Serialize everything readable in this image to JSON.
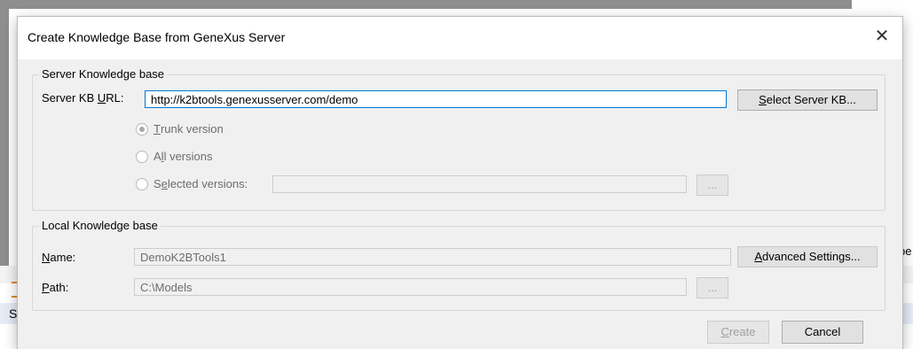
{
  "background": {
    "left_letter": "S",
    "right_text": "pe"
  },
  "dialog": {
    "title": "Create Knowledge Base from GeneXus Server",
    "close_glyph": "✕",
    "server_group": {
      "legend": "Server Knowledge base",
      "kb_url_label_pre": "Server KB ",
      "kb_url_label_u": "U",
      "kb_url_label_post": "RL:",
      "kb_url_value": "http://k2btools.genexusserver.com/demo",
      "select_button": {
        "u": "S",
        "rest": "elect Server KB..."
      },
      "radios": [
        {
          "u": "T",
          "rest": "runk version",
          "pre": "",
          "checked": true
        },
        {
          "pre": "A",
          "u": "l",
          "rest": "l versions",
          "checked": false
        },
        {
          "pre": "S",
          "u": "e",
          "rest": "lected versions:",
          "checked": false
        }
      ],
      "versions_value": "",
      "browse_label": "..."
    },
    "local_group": {
      "legend": "Local Knowledge base",
      "name_label": {
        "u": "N",
        "rest": "ame:"
      },
      "name_value": "DemoK2BTools1",
      "advanced_button": {
        "u": "A",
        "rest": "dvanced Settings..."
      },
      "path_label": {
        "u": "P",
        "rest": "ath:"
      },
      "path_value": "C:\\Models",
      "browse_label": "..."
    },
    "footer": {
      "create_button": {
        "u": "C",
        "rest": "reate"
      },
      "cancel_button": "Cancel"
    }
  }
}
